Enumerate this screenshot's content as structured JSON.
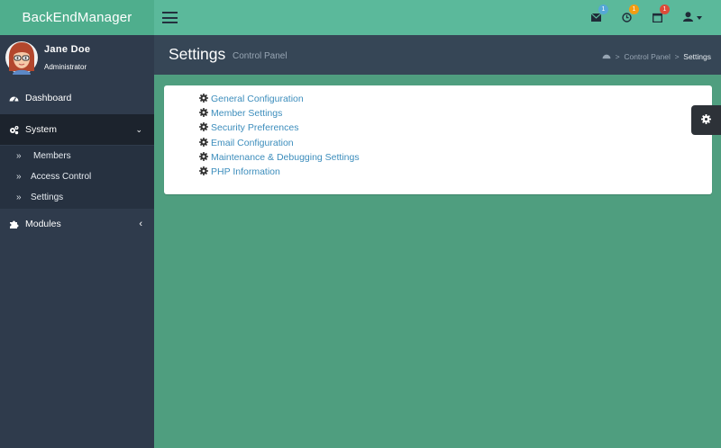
{
  "app": {
    "brand": "BackEndManager"
  },
  "header": {
    "notifications": [
      {
        "icon": "envelope-icon",
        "count": "1",
        "color": "#55a7d6"
      },
      {
        "icon": "clock-icon",
        "count": "1",
        "color": "#f39c12"
      },
      {
        "icon": "calendar-icon",
        "count": "1",
        "color": "#dd4b39"
      }
    ],
    "user_menu_icon": "user-icon"
  },
  "user": {
    "name": "Jane Doe",
    "role": "Administrator"
  },
  "sidebar": {
    "items": [
      {
        "label": "Dashboard",
        "icon": "dashboard-icon"
      },
      {
        "label": "System",
        "icon": "cogs-icon",
        "chevron": "chevron-down-icon",
        "children": [
          {
            "label": "Members"
          },
          {
            "label": "Access Control"
          },
          {
            "label": "Settings"
          }
        ]
      },
      {
        "label": "Modules",
        "icon": "puzzle-icon",
        "chevron": "chevron-left-icon"
      }
    ]
  },
  "page": {
    "title": "Settings",
    "subtitle": "Control Panel"
  },
  "breadcrumb": [
    {
      "label": "",
      "icon": "dashboard-icon"
    },
    {
      "label": "Control Panel"
    },
    {
      "label": "Settings"
    }
  ],
  "settings_links": [
    "General Configuration",
    "Member Settings",
    "Security Preferences",
    "Email Configuration",
    "Maintenance & Debugging Settings",
    "PHP Information"
  ],
  "colors": {
    "accent": "#5bb99b",
    "sidebar": "#2f3b4c",
    "link": "#3c8dbc",
    "content_bg": "#4f9e7f"
  }
}
